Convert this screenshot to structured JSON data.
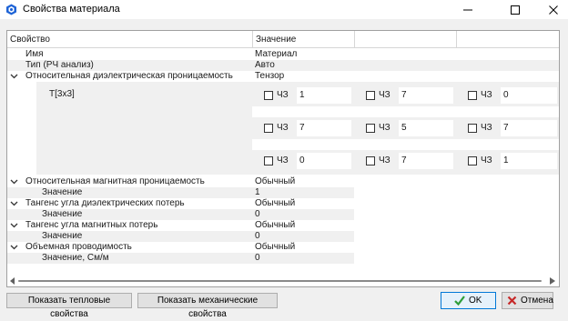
{
  "window": {
    "title": "Свойства материала",
    "icon": "app-gem-icon",
    "accent": "#1e63d6"
  },
  "grid": {
    "headers": [
      "Свойство",
      "Значение"
    ],
    "rows": [
      {
        "expander": false,
        "indent": false,
        "label": "Имя",
        "value": "Материал"
      },
      {
        "expander": false,
        "indent": false,
        "label": "Тип (РЧ анализ)",
        "value": "Авто"
      },
      {
        "expander": true,
        "indent": false,
        "label": "Относительная диэлектрическая проницаемость",
        "value": "Тензор"
      }
    ],
    "tensor": {
      "label": "T[3x3]",
      "checkbox_label": "ЧЗ",
      "cells": [
        [
          "1",
          "7",
          "0"
        ],
        [
          "7",
          "5",
          "7"
        ],
        [
          "0",
          "7",
          "1"
        ]
      ]
    },
    "rows_after": [
      {
        "expander": true,
        "indent": false,
        "label": "Относительная магнитная проницаемость",
        "value": "Обычный"
      },
      {
        "expander": false,
        "indent": true,
        "label": "Значение",
        "value": "1"
      },
      {
        "expander": true,
        "indent": false,
        "label": "Тангенс угла диэлектрических потерь",
        "value": "Обычный"
      },
      {
        "expander": false,
        "indent": true,
        "label": "Значение",
        "value": "0"
      },
      {
        "expander": true,
        "indent": false,
        "label": "Тангенс угла магнитных потерь",
        "value": "Обычный"
      },
      {
        "expander": false,
        "indent": true,
        "label": "Значение",
        "value": "0"
      },
      {
        "expander": true,
        "indent": false,
        "label": "Объемная проводимость",
        "value": "Обычный"
      },
      {
        "expander": false,
        "indent": true,
        "label": "Значение, См/м",
        "value": "0"
      }
    ]
  },
  "buttons": {
    "thermal": "Показать тепловые свойства",
    "mechanical": "Показать механические свойства",
    "ok": "OK",
    "cancel": "Отмена"
  },
  "colors": {
    "ok_check": "#2e9e3a",
    "cancel_x": "#c62828"
  }
}
